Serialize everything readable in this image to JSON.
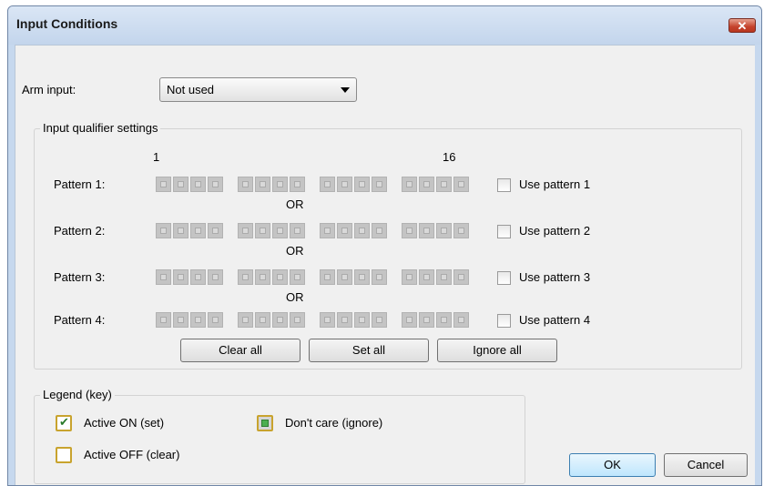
{
  "window": {
    "title": "Input Conditions",
    "close_glyph": "✕"
  },
  "arm": {
    "label": "Arm input:",
    "value": "Not used"
  },
  "qualifier": {
    "title": "Input qualifier settings",
    "bit_start": "1",
    "bit_end": "16",
    "or_label": "OR",
    "patterns": [
      {
        "label": "Pattern 1:",
        "checkbox_label": "Use pattern 1",
        "checked": false
      },
      {
        "label": "Pattern 2:",
        "checkbox_label": "Use pattern 2",
        "checked": false
      },
      {
        "label": "Pattern 3:",
        "checkbox_label": "Use pattern 3",
        "checked": false
      },
      {
        "label": "Pattern 4:",
        "checkbox_label": "Use pattern 4",
        "checked": false
      }
    ],
    "buttons": {
      "clear_all": "Clear all",
      "set_all": "Set all",
      "ignore_all": "Ignore all"
    }
  },
  "legend": {
    "title": "Legend (key)",
    "active_on": "Active ON (set)",
    "dont_care": "Don't care (ignore)",
    "active_off": "Active OFF (clear)"
  },
  "dialog_buttons": {
    "ok": "OK",
    "cancel": "Cancel"
  },
  "colors": {
    "legend_border": "#c8a32e",
    "check_mark": "#2a7a2a",
    "dont_care_fill": "#4caf50"
  }
}
